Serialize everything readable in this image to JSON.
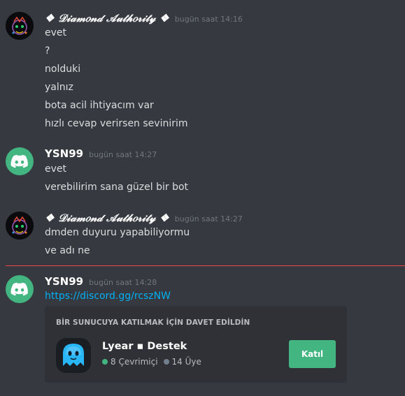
{
  "messages": [
    {
      "username": "❖ 𝒟𝒾𝒶𝓂𝑜𝓃𝒹 𝒜𝓊𝓉𝒽𝑜𝓇𝒾𝓉𝓎 ❖",
      "timestamp": "bugün saat 14:16",
      "lines": [
        "evet",
        "?",
        "nolduki",
        "yalnız",
        "bota acil ihtiyacım var",
        "hızlı cevap verirsen sevinirim"
      ]
    },
    {
      "username": "YSN99",
      "timestamp": "bugün saat 14:27",
      "lines": [
        "evet",
        "verebilirim sana güzel bir bot"
      ]
    },
    {
      "username": "❖ 𝒟𝒾𝒶𝓂𝑜𝓃𝒹 𝒜𝓊𝓉𝒽𝑜𝓇𝒾𝓉𝓎 ❖",
      "timestamp": "bugün saat 14:27",
      "lines": [
        "dmden duyuru yapabiliyormu",
        "ve adı ne"
      ]
    },
    {
      "username": "YSN99",
      "timestamp": "bugün saat 14:28",
      "link": "https://discord.gg/rcszNW"
    }
  ],
  "invite": {
    "title": "BİR SUNUCUYA KATILMAK İÇİN DAVET EDİLDİN",
    "server_name": "Lyear ▪ Destek",
    "online": "8 Çevrimiçi",
    "members": "14 Üye",
    "join_label": "Katıl"
  },
  "colors": {
    "background": "#36393f",
    "embed": "#2f3136",
    "accent_green": "#43b581",
    "link": "#00b0f4",
    "new_divider": "#f04747"
  }
}
